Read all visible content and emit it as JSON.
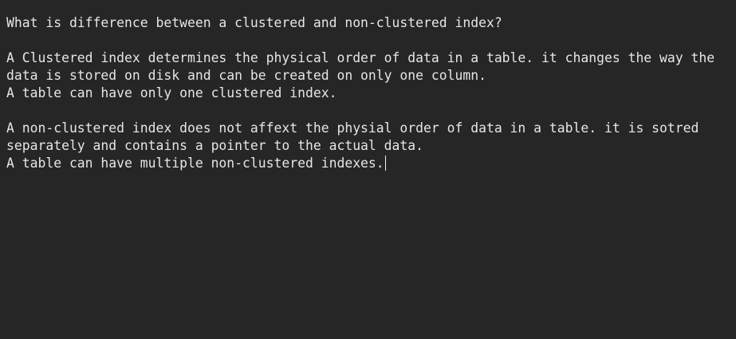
{
  "editor": {
    "background": "#262626",
    "text_color": "#e6e6e6",
    "lines": [
      "What is difference between a clustered and non-clustered index?",
      "",
      "A Clustered index determines the physical order of data in a table. it changes the way the",
      "data is stored on disk and can be created on only one column.",
      "A table can have only one clustered index.",
      "",
      "A non-clustered index does not affext the physial order of data in a table. it is sotred",
      "separately and contains a pointer to the actual data.",
      "A table can have multiple non-clustered indexes."
    ]
  }
}
